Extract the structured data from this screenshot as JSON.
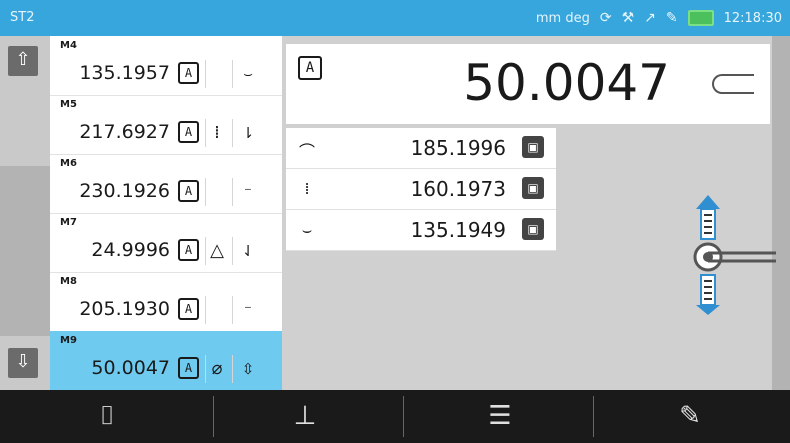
{
  "status": {
    "title": "ST2",
    "units": "mm deg",
    "time": "12:18:30",
    "colors": {
      "bar": "#37a6dc",
      "battery": "#4cc05c"
    }
  },
  "nav": {
    "scroll_up": "⇧",
    "scroll_down": "⇩"
  },
  "features": [
    {
      "label": "M4",
      "value": "135.1957",
      "badge": "A",
      "symbol": "",
      "direction": "⌣"
    },
    {
      "label": "M5",
      "value": "217.6927",
      "badge": "A",
      "symbol": "⁞",
      "direction": "⇂"
    },
    {
      "label": "M6",
      "value": "230.1926",
      "badge": "A",
      "symbol": "",
      "direction": "⁻"
    },
    {
      "label": "M7",
      "value": "24.9996",
      "badge": "A",
      "symbol": "△",
      "direction": "⇃"
    },
    {
      "label": "M8",
      "value": "205.1930",
      "badge": "A",
      "symbol": "",
      "direction": "⁻"
    },
    {
      "label": "M9",
      "value": "50.0047",
      "badge": "A",
      "symbol": "⌀",
      "direction": "⇳"
    }
  ],
  "main": {
    "badge": "A",
    "big_value": "50.0047",
    "points": [
      {
        "direction": "⌒",
        "value": "185.1996"
      },
      {
        "direction": "⁞",
        "value": "160.1973"
      },
      {
        "direction": "⌣",
        "value": "135.1949"
      }
    ]
  },
  "toolbar": [
    {
      "icon": "bracket-icon",
      "glyph": "⌷"
    },
    {
      "icon": "probe-point-icon",
      "glyph": "⊥"
    },
    {
      "icon": "list-delete-icon",
      "glyph": "☰"
    },
    {
      "icon": "list-edit-icon",
      "glyph": "✎"
    }
  ]
}
